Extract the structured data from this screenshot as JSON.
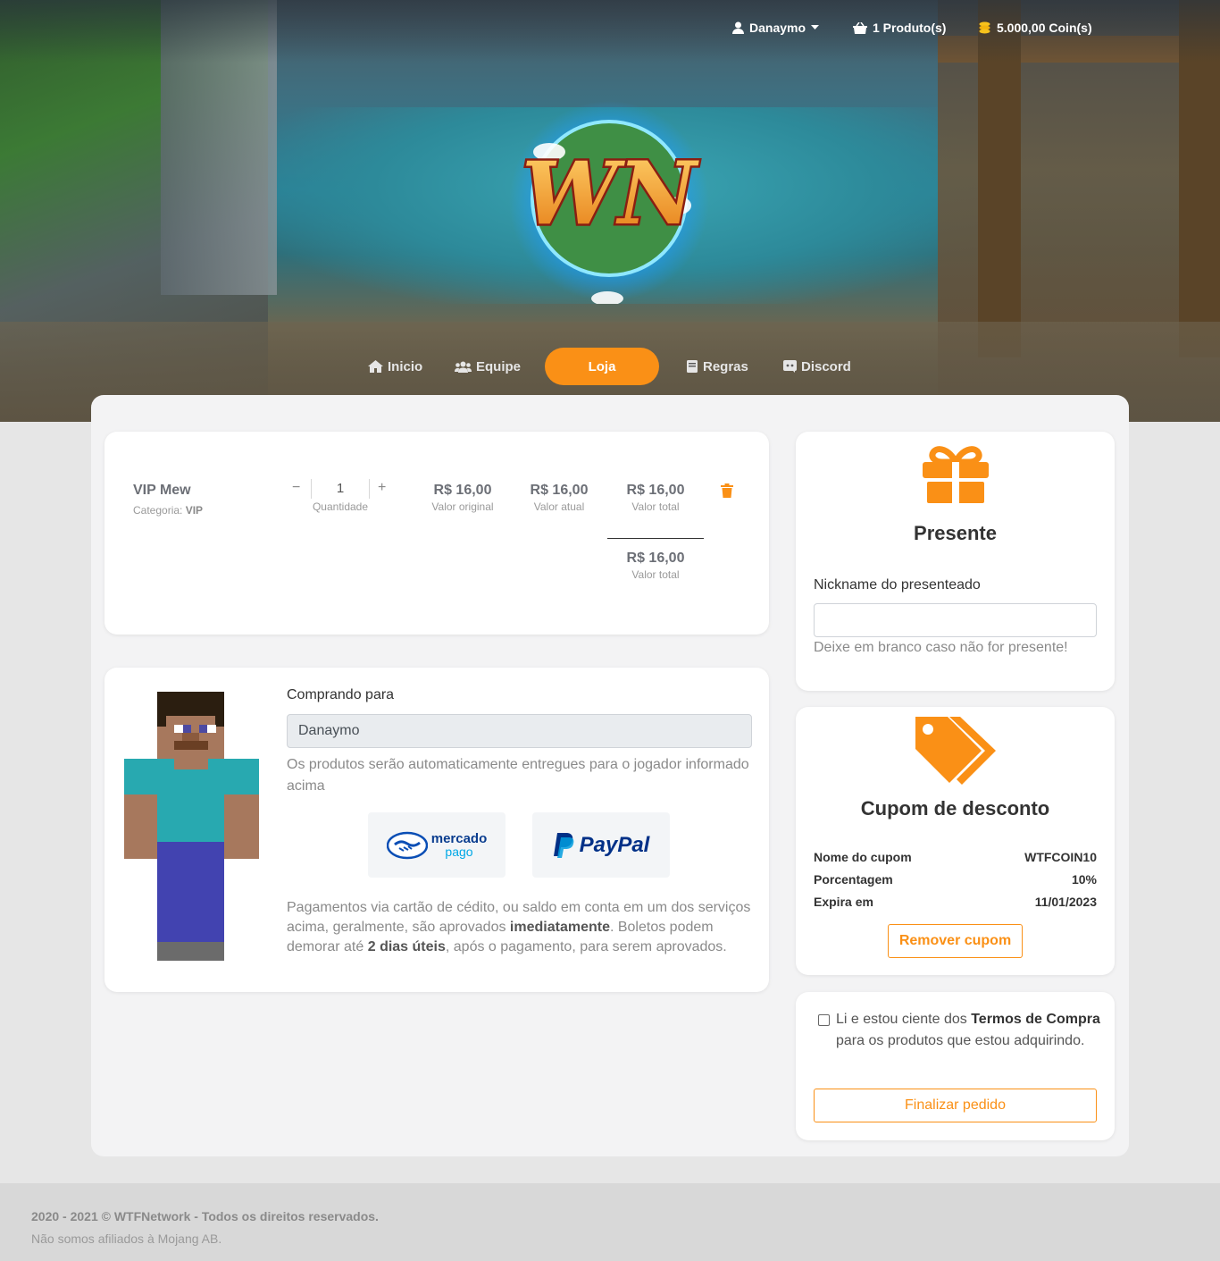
{
  "topnav": {
    "user": "Danaymo",
    "cart": "1 Produto(s)",
    "coins": "5.000,00 Coin(s)"
  },
  "menu": {
    "inicio": "Inicio",
    "equipe": "Equipe",
    "loja": "Loja",
    "regras": "Regras",
    "discord": "Discord"
  },
  "cart_item": {
    "name": "VIP Mew",
    "category_label": "Categoria:",
    "category": "VIP",
    "quantity": "1",
    "quantity_label": "Quantidade",
    "original_value": "R$ 16,00",
    "original_label": "Valor original",
    "current_value": "R$ 16,00",
    "current_label": "Valor atual",
    "total_value": "R$ 16,00",
    "total_label": "Valor total",
    "grand_total_value": "R$ 16,00",
    "grand_total_label": "Valor total"
  },
  "buyer": {
    "label": "Comprando para",
    "value": "Danaymo",
    "note": "Os produtos serão automaticamente entregues para o jogador informado acima",
    "payment_part1": "Pagamentos via cartão de cédito, ou saldo em conta em um dos serviços acima, geralmente, são aprovados ",
    "payment_bold1": "imediatamente",
    "payment_part2": ". Boletos podem demorar até ",
    "payment_bold2": "2 dias úteis",
    "payment_part3": ", após o pagamento, para serem aprovados.",
    "mercadopago_line1": "mercado",
    "mercadopago_line2": "pago",
    "paypal": "PayPal"
  },
  "gift": {
    "title": "Presente",
    "label": "Nickname do presenteado",
    "value": "",
    "hint": "Deixe em branco caso não for presente!"
  },
  "coupon": {
    "title": "Cupom de desconto",
    "rows": [
      {
        "label": "Nome do cupom",
        "value": "WTFCOIN10"
      },
      {
        "label": "Porcentagem",
        "value": "10%"
      },
      {
        "label": "Expira em",
        "value": "11/01/2023"
      }
    ],
    "remove_label": "Remover cupom"
  },
  "terms": {
    "part1": "Li e estou ciente dos ",
    "bold": "Termos de Compra",
    "part2": " para os produtos que estou adquirindo.",
    "checked": false,
    "finish_label": "Finalizar pedido"
  },
  "footer": {
    "copyright": "2020 - 2021 © WTFNetwork - Todos os direitos reservados.",
    "disclaimer": "Não somos afiliados à Mojang AB."
  },
  "colors": {
    "accent": "#fa9016",
    "text": "#333333",
    "muted": "#9a9a9a"
  },
  "logo_text": "WN"
}
